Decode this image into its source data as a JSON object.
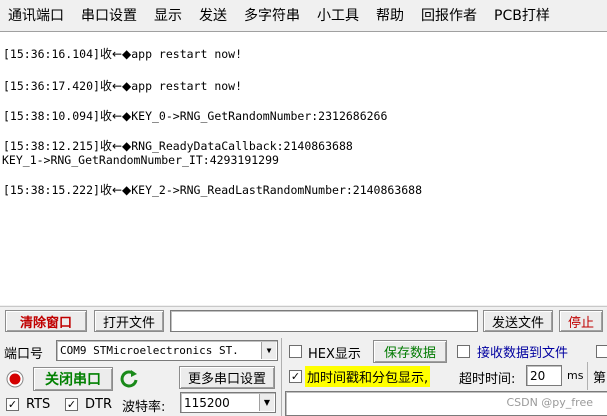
{
  "menu": [
    "通讯端口",
    "串口设置",
    "显示",
    "发送",
    "多字符串",
    "小工具",
    "帮助",
    "回报作者",
    "PCB打样"
  ],
  "receive": {
    "lines": [
      {
        "time": "[15:36:16.104]",
        "dir": "收←◆",
        "text": "app restart now!"
      },
      {
        "time": "[15:36:17.420]",
        "dir": "收←◆",
        "text": "app restart now!"
      },
      {
        "time": "[15:38:10.094]",
        "dir": "收←◆",
        "text": "KEY_0->RNG_GetRandomNumber:2312686266"
      },
      {
        "time": "[15:38:12.215]",
        "dir": "收←◆",
        "text": "RNG_ReadyDataCallback:2140863688"
      },
      {
        "time": "",
        "dir": "",
        "text": "KEY_1->RNG_GetRandomNumber_IT:4293191299"
      },
      {
        "time": "[15:38:15.222]",
        "dir": "收←◆",
        "text": "KEY_2->RNG_ReadLastRandomNumber:2140863688"
      }
    ]
  },
  "toolbar": {
    "clear_window": "清除窗口",
    "open_file": "打开文件",
    "file_path": "",
    "send_file": "发送文件",
    "stop": "停止"
  },
  "port": {
    "port_label": "端口号",
    "port_value": "COM9 STMicroelectronics ST.",
    "close_port": "关闭串口",
    "more_settings": "更多串口设置",
    "rts_label": "RTS",
    "dtr_label": "DTR",
    "baud_label": "波特率:",
    "baud_value": "115200"
  },
  "options": {
    "hex_display": "HEX显示",
    "save_data": "保存数据",
    "recv_to_file": "接收数据到文件",
    "timestamp": "加时间戳和分包显示,",
    "timeout_label": "超时时间:",
    "timeout_value": "20",
    "timeout_unit": "ms",
    "next_label": "第"
  },
  "watermark": "CSDN @py_free",
  "colors": {
    "clear_red": "#c00000",
    "save_green": "#007a00",
    "close_green": "#008000",
    "link_blue": "#0000a0",
    "highlight_yellow": "#ffff00"
  }
}
